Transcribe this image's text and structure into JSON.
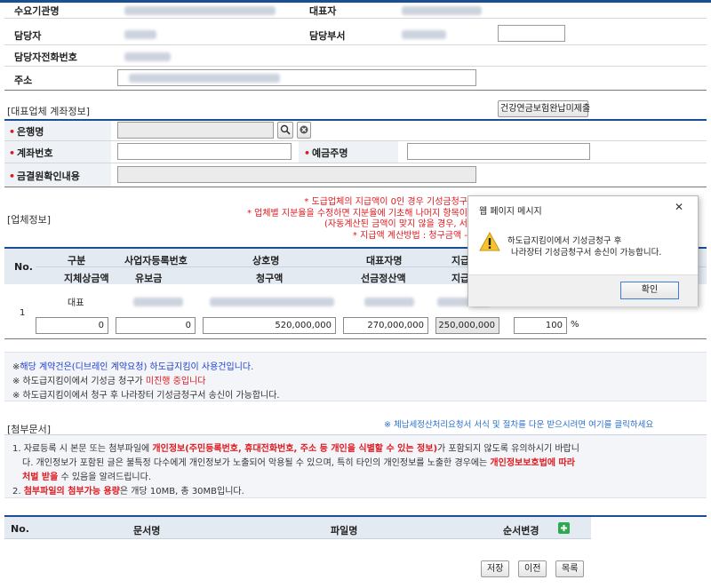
{
  "company": {
    "client_name_label": "수요기관명",
    "ceo_label": "대표자",
    "manager_label": "담당자",
    "dept_label": "담당부서",
    "phone_label": "담당자전화번호",
    "address_label": "주소"
  },
  "account": {
    "section_title": "[대표업체 계좌정보]",
    "pension_button": "건강연금보험완납미제출",
    "bank_label": "은행명",
    "account_no_label": "계좌번호",
    "holder_label": "예금주명",
    "verify_label": "금결원확인내용"
  },
  "vendor": {
    "section_title": "[업체정보]",
    "notices": [
      "* 도급업체의 지급액이 0인 경우 기성금청구",
      "* 업체별 지분율을 수정하면 지분율에 기초해 나머지 항목이",
      "(자동계산된 금액이 맞지 않을 경우, 서",
      "* 지급액 계산방법 : 청구금액 -"
    ],
    "table": {
      "no_header": "No.",
      "headers_row1": [
        "구분",
        "사업자등록번호",
        "상호명",
        "대표자명",
        "지급"
      ],
      "headers_row2": [
        "지체상금액",
        "유보금",
        "청구액",
        "선금정산액",
        "지급"
      ],
      "row_no": "1",
      "row_type": "대표",
      "values": [
        "0",
        "0",
        "520,000,000",
        "270,000,000",
        "250,000,000",
        "100"
      ],
      "percent_unit": "%"
    }
  },
  "info_box": {
    "line1_prefix": "※",
    "line1_blue": "해당 계약건은(디브레인 계약요청) 하도급지킴이 사용건입니다.",
    "line2_prefix": "※ 하도급지킴이에서 기성금 청구가 ",
    "line2_red": "미진행 중입니다",
    "line3": "※ 하도급지킴이에서 청구 후 나라장터 기성금청구서 송신이 가능합니다."
  },
  "attachments": {
    "section_title": "[첨부문서]",
    "link_text": "※ 체납세정산처리요청서 서식 및 절차를 다운 받으시려면 여기를 클릭하세요",
    "note1_a": "1.  자료등록 시 본문 또는 첨부파일에 ",
    "note1_red": "개인정보(주민등록번호, 휴대전화번호, 주소 등 개인을 식별할 수 있는 정보)",
    "note1_b": "가 포함되지 않도록 유의하시기 바랍니",
    "note2_a": "다. 개인정보가 포함된 글은 불특정 다수에게 개인정보가 노출되어 악용될 수 있으며, 특히 타인의 개인정보를 노출한 경우에는 ",
    "note2_red": "개인정보보호법에 따라",
    "note3_red": "처벌 받을",
    "note3_b": " 수 있음을 알려드립니다.",
    "note4_a": "2.  ",
    "note4_red": "첨부파일의 첨부가능 용량",
    "note4_b": "은 개당 10MB, 총 30MB입니다.",
    "table_headers": [
      "No.",
      "문서명",
      "파일명",
      "순서변경"
    ],
    "add_icon": "plus-icon"
  },
  "footer": {
    "save": "저장",
    "prev": "이전",
    "list": "목록"
  },
  "dialog": {
    "title": "웹 페이지 메시지",
    "close": "✕",
    "message_line1": "하도급지킴이에서 기성금청구 후",
    "message_line2": "나라장터 기성금청구서 송신이 가능합니다.",
    "ok": "확인",
    "icon": "warning-icon"
  }
}
